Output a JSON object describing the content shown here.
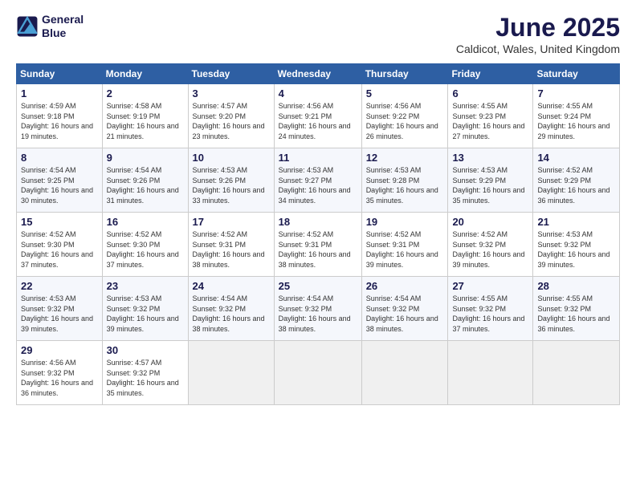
{
  "logo": {
    "line1": "General",
    "line2": "Blue"
  },
  "title": "June 2025",
  "subtitle": "Caldicot, Wales, United Kingdom",
  "days_header": [
    "Sunday",
    "Monday",
    "Tuesday",
    "Wednesday",
    "Thursday",
    "Friday",
    "Saturday"
  ],
  "weeks": [
    [
      {
        "day": "1",
        "rise": "Sunrise: 4:59 AM",
        "set": "Sunset: 9:18 PM",
        "daylight": "Daylight: 16 hours and 19 minutes."
      },
      {
        "day": "2",
        "rise": "Sunrise: 4:58 AM",
        "set": "Sunset: 9:19 PM",
        "daylight": "Daylight: 16 hours and 21 minutes."
      },
      {
        "day": "3",
        "rise": "Sunrise: 4:57 AM",
        "set": "Sunset: 9:20 PM",
        "daylight": "Daylight: 16 hours and 23 minutes."
      },
      {
        "day": "4",
        "rise": "Sunrise: 4:56 AM",
        "set": "Sunset: 9:21 PM",
        "daylight": "Daylight: 16 hours and 24 minutes."
      },
      {
        "day": "5",
        "rise": "Sunrise: 4:56 AM",
        "set": "Sunset: 9:22 PM",
        "daylight": "Daylight: 16 hours and 26 minutes."
      },
      {
        "day": "6",
        "rise": "Sunrise: 4:55 AM",
        "set": "Sunset: 9:23 PM",
        "daylight": "Daylight: 16 hours and 27 minutes."
      },
      {
        "day": "7",
        "rise": "Sunrise: 4:55 AM",
        "set": "Sunset: 9:24 PM",
        "daylight": "Daylight: 16 hours and 29 minutes."
      }
    ],
    [
      {
        "day": "8",
        "rise": "Sunrise: 4:54 AM",
        "set": "Sunset: 9:25 PM",
        "daylight": "Daylight: 16 hours and 30 minutes."
      },
      {
        "day": "9",
        "rise": "Sunrise: 4:54 AM",
        "set": "Sunset: 9:26 PM",
        "daylight": "Daylight: 16 hours and 31 minutes."
      },
      {
        "day": "10",
        "rise": "Sunrise: 4:53 AM",
        "set": "Sunset: 9:26 PM",
        "daylight": "Daylight: 16 hours and 33 minutes."
      },
      {
        "day": "11",
        "rise": "Sunrise: 4:53 AM",
        "set": "Sunset: 9:27 PM",
        "daylight": "Daylight: 16 hours and 34 minutes."
      },
      {
        "day": "12",
        "rise": "Sunrise: 4:53 AM",
        "set": "Sunset: 9:28 PM",
        "daylight": "Daylight: 16 hours and 35 minutes."
      },
      {
        "day": "13",
        "rise": "Sunrise: 4:53 AM",
        "set": "Sunset: 9:29 PM",
        "daylight": "Daylight: 16 hours and 35 minutes."
      },
      {
        "day": "14",
        "rise": "Sunrise: 4:52 AM",
        "set": "Sunset: 9:29 PM",
        "daylight": "Daylight: 16 hours and 36 minutes."
      }
    ],
    [
      {
        "day": "15",
        "rise": "Sunrise: 4:52 AM",
        "set": "Sunset: 9:30 PM",
        "daylight": "Daylight: 16 hours and 37 minutes."
      },
      {
        "day": "16",
        "rise": "Sunrise: 4:52 AM",
        "set": "Sunset: 9:30 PM",
        "daylight": "Daylight: 16 hours and 37 minutes."
      },
      {
        "day": "17",
        "rise": "Sunrise: 4:52 AM",
        "set": "Sunset: 9:31 PM",
        "daylight": "Daylight: 16 hours and 38 minutes."
      },
      {
        "day": "18",
        "rise": "Sunrise: 4:52 AM",
        "set": "Sunset: 9:31 PM",
        "daylight": "Daylight: 16 hours and 38 minutes."
      },
      {
        "day": "19",
        "rise": "Sunrise: 4:52 AM",
        "set": "Sunset: 9:31 PM",
        "daylight": "Daylight: 16 hours and 39 minutes."
      },
      {
        "day": "20",
        "rise": "Sunrise: 4:52 AM",
        "set": "Sunset: 9:32 PM",
        "daylight": "Daylight: 16 hours and 39 minutes."
      },
      {
        "day": "21",
        "rise": "Sunrise: 4:53 AM",
        "set": "Sunset: 9:32 PM",
        "daylight": "Daylight: 16 hours and 39 minutes."
      }
    ],
    [
      {
        "day": "22",
        "rise": "Sunrise: 4:53 AM",
        "set": "Sunset: 9:32 PM",
        "daylight": "Daylight: 16 hours and 39 minutes."
      },
      {
        "day": "23",
        "rise": "Sunrise: 4:53 AM",
        "set": "Sunset: 9:32 PM",
        "daylight": "Daylight: 16 hours and 39 minutes."
      },
      {
        "day": "24",
        "rise": "Sunrise: 4:54 AM",
        "set": "Sunset: 9:32 PM",
        "daylight": "Daylight: 16 hours and 38 minutes."
      },
      {
        "day": "25",
        "rise": "Sunrise: 4:54 AM",
        "set": "Sunset: 9:32 PM",
        "daylight": "Daylight: 16 hours and 38 minutes."
      },
      {
        "day": "26",
        "rise": "Sunrise: 4:54 AM",
        "set": "Sunset: 9:32 PM",
        "daylight": "Daylight: 16 hours and 38 minutes."
      },
      {
        "day": "27",
        "rise": "Sunrise: 4:55 AM",
        "set": "Sunset: 9:32 PM",
        "daylight": "Daylight: 16 hours and 37 minutes."
      },
      {
        "day": "28",
        "rise": "Sunrise: 4:55 AM",
        "set": "Sunset: 9:32 PM",
        "daylight": "Daylight: 16 hours and 36 minutes."
      }
    ],
    [
      {
        "day": "29",
        "rise": "Sunrise: 4:56 AM",
        "set": "Sunset: 9:32 PM",
        "daylight": "Daylight: 16 hours and 36 minutes."
      },
      {
        "day": "30",
        "rise": "Sunrise: 4:57 AM",
        "set": "Sunset: 9:32 PM",
        "daylight": "Daylight: 16 hours and 35 minutes."
      },
      null,
      null,
      null,
      null,
      null
    ]
  ]
}
